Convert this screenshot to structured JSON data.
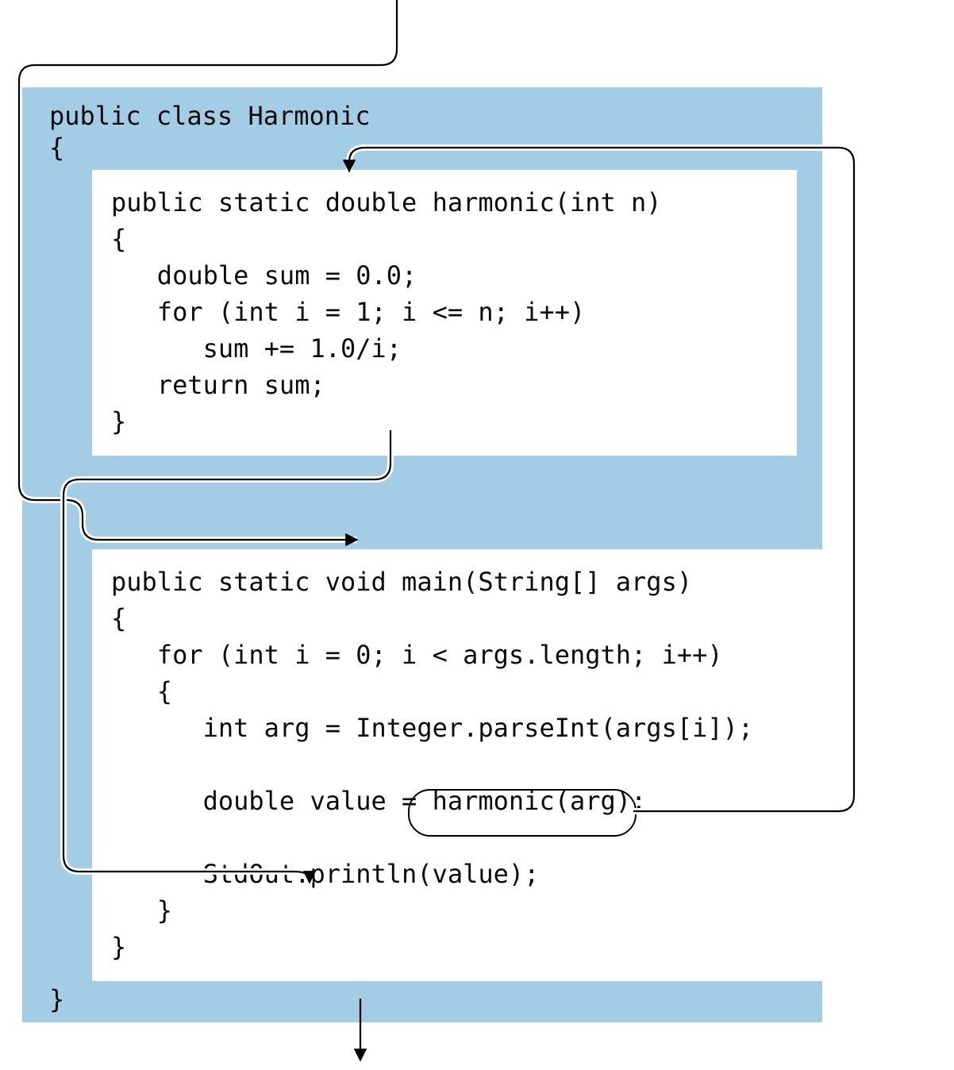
{
  "class_header": "public class Harmonic\n{",
  "class_close": "}",
  "harmonic_code": "public static double harmonic(int n)\n{\n   double sum = 0.0;\n   for (int i = 1; i <= n; i++)\n      sum += 1.0/i;\n   return sum;\n}",
  "main_code": "public static void main(String[] args)\n{\n   for (int i = 0; i < args.length; i++)\n   {\n      int arg = Integer.parseInt(args[i]);\n\n      double value = harmonic(arg);\n\n      StdOut.println(value);\n   }\n}"
}
